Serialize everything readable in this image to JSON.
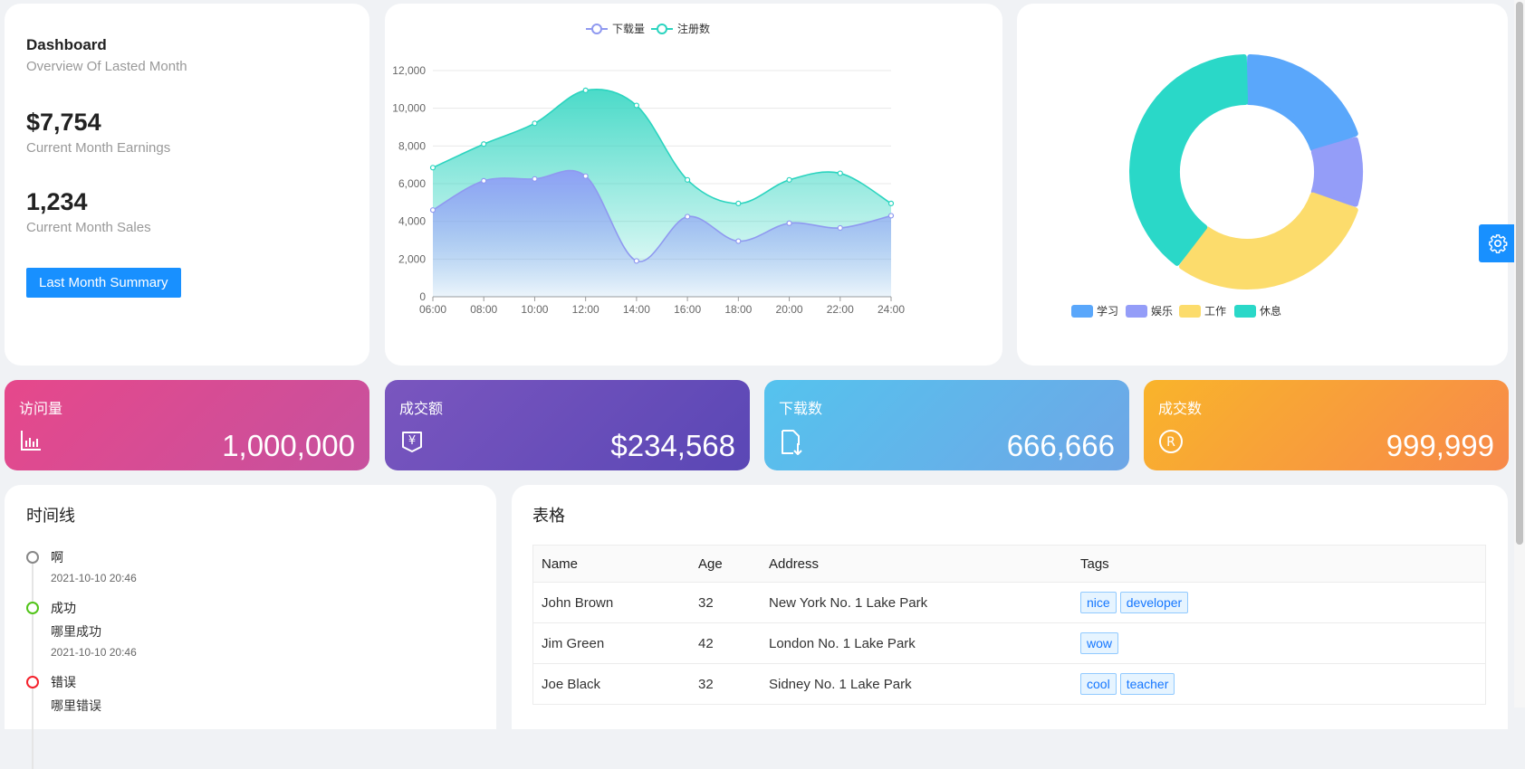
{
  "summary": {
    "title": "Dashboard",
    "subtitle": "Overview Of Lasted Month",
    "earnings_value": "$7,754",
    "earnings_caption": "Current Month Earnings",
    "sales_value": "1,234",
    "sales_caption": "Current Month Sales",
    "button_label": "Last Month Summary"
  },
  "chart_data": [
    {
      "type": "area",
      "categories": [
        "06:00",
        "08:00",
        "10:00",
        "12:00",
        "14:00",
        "16:00",
        "18:00",
        "20:00",
        "22:00",
        "24:00"
      ],
      "series": [
        {
          "name": "下载量",
          "color": "#8f99f0",
          "values": [
            4600,
            6150,
            6250,
            6400,
            1900,
            4250,
            2950,
            3900,
            3650,
            4300
          ]
        },
        {
          "name": "注册数",
          "color": "#2bd4bf",
          "values": [
            6850,
            8100,
            9200,
            10950,
            10150,
            6200,
            4950,
            6200,
            6550,
            4950
          ]
        }
      ],
      "ylim": [
        0,
        12000
      ],
      "yticks": [
        "0",
        "2,000",
        "4,000",
        "6,000",
        "8,000",
        "10,000",
        "12,000"
      ],
      "legend": "top-center"
    },
    {
      "type": "pie",
      "variant": "donut",
      "slices": [
        {
          "name": "学习",
          "value": 20,
          "color": "#5aa7fb"
        },
        {
          "name": "娱乐",
          "value": 10,
          "color": "#949df8"
        },
        {
          "name": "工作",
          "value": 30,
          "color": "#fcdc6c"
        },
        {
          "name": "休息",
          "value": 40,
          "color": "#2ad8c8"
        }
      ],
      "legend": "bottom-center"
    }
  ],
  "stats": [
    {
      "label": "访问量",
      "value": "1,000,000",
      "icon": "bar-chart-icon"
    },
    {
      "label": "成交额",
      "value": "$234,568",
      "icon": "money-icon"
    },
    {
      "label": "下载数",
      "value": "666,666",
      "icon": "download-file-icon"
    },
    {
      "label": "成交数",
      "value": "999,999",
      "icon": "registered-icon"
    }
  ],
  "timeline": {
    "title": "时间线",
    "items": [
      {
        "title": "啊",
        "desc": "",
        "time": "2021-10-10 20:46",
        "color": "#888888"
      },
      {
        "title": "成功",
        "desc": "哪里成功",
        "time": "2021-10-10 20:46",
        "color": "#52c41a"
      },
      {
        "title": "错误",
        "desc": "哪里错误",
        "time": "",
        "color": "#f5222d"
      }
    ]
  },
  "table": {
    "title": "表格",
    "columns": [
      "Name",
      "Age",
      "Address",
      "Tags"
    ],
    "rows": [
      {
        "name": "John Brown",
        "age": "32",
        "address": "New York No. 1 Lake Park",
        "tags": [
          "nice",
          "developer"
        ]
      },
      {
        "name": "Jim Green",
        "age": "42",
        "address": "London No. 1 Lake Park",
        "tags": [
          "wow"
        ]
      },
      {
        "name": "Joe Black",
        "age": "32",
        "address": "Sidney No. 1 Lake Park",
        "tags": [
          "cool",
          "teacher"
        ]
      }
    ]
  },
  "settings": {
    "icon": "gear-icon"
  }
}
